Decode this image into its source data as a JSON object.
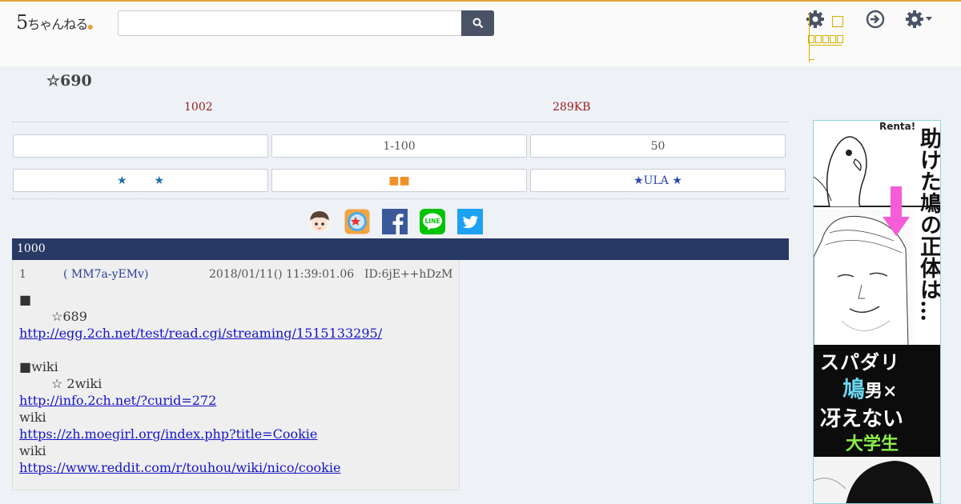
{
  "header": {
    "logo": {
      "main": "5",
      "tail": "ちゃんねる"
    },
    "search": {
      "placeholder": ""
    }
  },
  "thread": {
    "title": "☆690",
    "count": "1002",
    "size": "289KB",
    "buttons_row1": [
      "",
      "1-100",
      "50"
    ],
    "buttons_row2": [
      {
        "left": "★",
        "right": "★"
      },
      {
        "text": "■■"
      },
      {
        "text": "★ULA ★"
      }
    ],
    "bar_text": "1000"
  },
  "share_icons": [
    "mascot-icon",
    "app-icon",
    "facebook-icon",
    "line-icon",
    "twitter-icon"
  ],
  "post": {
    "number": "1",
    "name": "( MM7a-yEMv)",
    "date": "2018/01/11() 11:39:01.06",
    "id": "ID:6jE++hDzM",
    "lines": {
      "l1": "■",
      "l2": "☆689",
      "l3": "http://egg.2ch.net/test/read.cgi/streaming/1515133295/",
      "l4": "■wiki",
      "l5": "☆ 2wiki",
      "l6": "http://info.2ch.net/?curid=272",
      "l7": "wiki",
      "l8": "https://zh.moegirl.org/index.php?title=Cookie",
      "l9": "wiki",
      "l10": "https://www.reddit.com/r/touhou/wiki/nico/cookie"
    }
  },
  "ad": {
    "brand": "Renta!",
    "headline": "助けた鳩の正体は…",
    "line1": "スパダリ",
    "line2_main": "鳩",
    "line2_sub": "男",
    "line2_x": "×",
    "line3": "冴えない",
    "line4": "大学生"
  },
  "colors": {
    "header_accent": "#e8a23a",
    "thread_bar": "#283963",
    "meta_red": "#9b1c1c",
    "link": "#1414c8"
  }
}
